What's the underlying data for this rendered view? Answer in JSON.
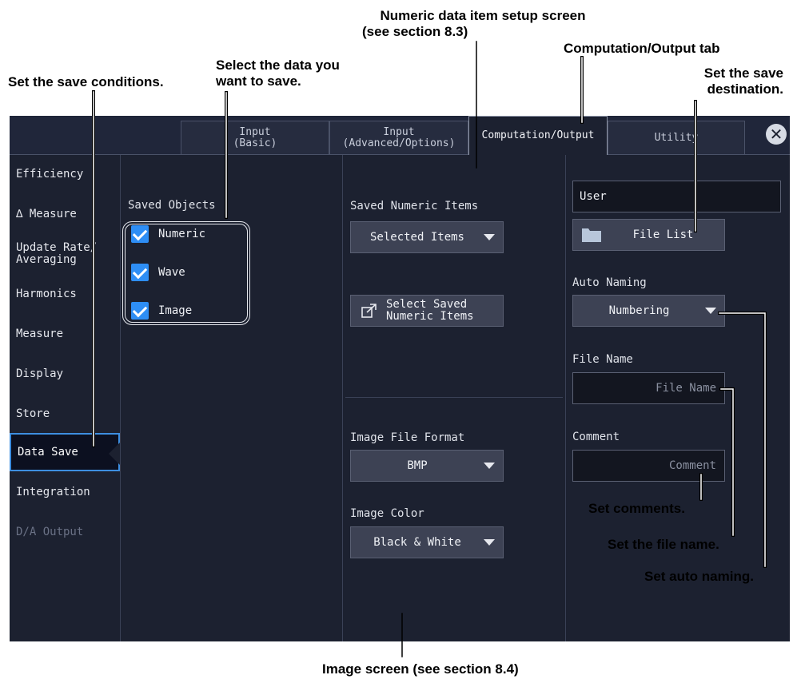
{
  "callouts": {
    "numeric_setup_line1": "Numeric data item setup screen",
    "numeric_setup_line2": "(see section 8.3)",
    "computation_tab": "Computation/Output tab",
    "select_data_line1": "Select the data you",
    "select_data_line2": "want to save.",
    "save_conditions": "Set the save conditions.",
    "save_destination_line1": "Set the save",
    "save_destination_line2": "destination.",
    "set_comments": "Set comments.",
    "set_file_name": "Set the file name.",
    "set_auto_naming": "Set auto naming.",
    "image_screen": "Image screen (see section 8.4)"
  },
  "tabs": {
    "input_basic_line1": "Input",
    "input_basic_line2": "(Basic)",
    "input_adv_line1": "Input",
    "input_adv_line2": "(Advanced/Options)",
    "computation_output": "Computation/Output",
    "utility": "Utility",
    "close_glyph": "✕"
  },
  "sidebar": {
    "items": [
      {
        "label": "Efficiency"
      },
      {
        "label": "∆ Measure"
      },
      {
        "label": "Update Rate/\nAveraging"
      },
      {
        "label": "Harmonics"
      },
      {
        "label": "Measure"
      },
      {
        "label": "Display"
      },
      {
        "label": "Store"
      },
      {
        "label": "Data Save"
      },
      {
        "label": "Integration"
      },
      {
        "label": "D/A Output"
      }
    ],
    "active": "Data Save",
    "disabled": "D/A Output"
  },
  "saved_objects": {
    "title": "Saved Objects",
    "items": [
      {
        "label": "Numeric",
        "checked": true
      },
      {
        "label": "Wave",
        "checked": true
      },
      {
        "label": "Image",
        "checked": true
      }
    ]
  },
  "numeric": {
    "title": "Saved Numeric Items",
    "value": "Selected Items",
    "select_button_line1": "Select Saved",
    "select_button_line2": "Numeric Items"
  },
  "image": {
    "format_title": "Image File Format",
    "format_value": "BMP",
    "color_title": "Image Color",
    "color_value": "Black & White"
  },
  "destination": {
    "path": "User",
    "file_list": "File List",
    "auto_naming_title": "Auto Naming",
    "auto_naming_value": "Numbering",
    "file_name_title": "File Name",
    "file_name_placeholder": "File Name",
    "comment_title": "Comment",
    "comment_placeholder": "Comment"
  },
  "colors": {
    "screen_bg": "#1c2130",
    "accent": "#2e8ef5",
    "active_border": "#3d8ee0",
    "button_bg": "#3d4254"
  }
}
